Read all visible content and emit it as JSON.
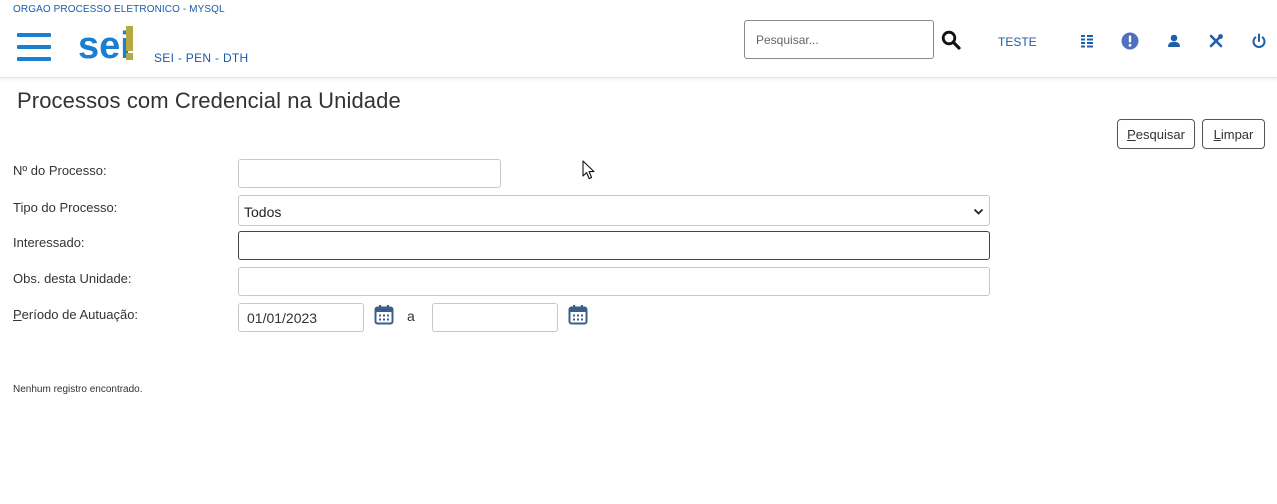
{
  "header": {
    "org_name": "ORGAO PROCESSO ELETRONICO - MYSQL",
    "logo_text": "sei!",
    "system_name": "SEI - PEN - DTH",
    "search_placeholder": "Pesquisar...",
    "unit_name": "TESTE",
    "icons": [
      "menu-icon",
      "search-icon",
      "grid-list-icon",
      "info-alert-icon",
      "user-icon",
      "tools-icon",
      "power-icon"
    ]
  },
  "page": {
    "title": "Processos com Credencial na Unidade",
    "buttons": {
      "search_accesskey": "P",
      "search_rest": "esquisar",
      "clear_accesskey": "L",
      "clear_rest": "impar"
    }
  },
  "form": {
    "processo_label": "Nº do Processo:",
    "processo_value": "",
    "tipo_label": "Tipo do Processo:",
    "tipo_value": "Todos",
    "interessado_label": "Interessado:",
    "interessado_value": "",
    "obs_label": "Obs. desta Unidade:",
    "obs_value": "",
    "periodo_label_accesskey": "P",
    "periodo_label_rest": "eríodo de Autuação:",
    "periodo_start": "01/01/2023",
    "periodo_separator": "a",
    "periodo_end": ""
  },
  "results": {
    "message": "Nenhum registro encontrado."
  },
  "colors": {
    "brand_blue": "#1a7ed1",
    "link_blue": "#1a5ba8",
    "logo_accent": "#b7a842",
    "icon_blue": "#1f5ea8"
  }
}
